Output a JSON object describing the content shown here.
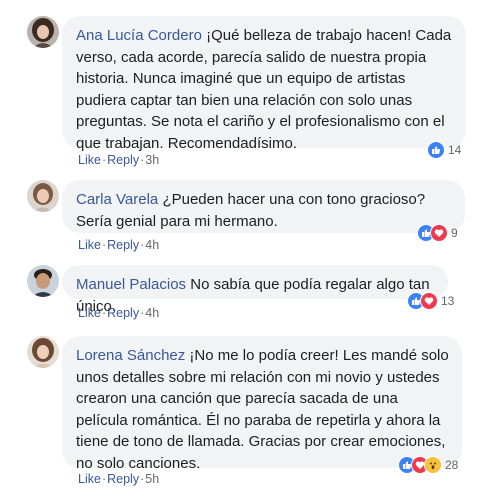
{
  "comments": [
    {
      "name": "Ana Lucía Cordero",
      "text": "¡Qué belleza de trabajo hacen! Cada verso, cada acorde, parecía salido de nuestra propia historia. Nunca imaginé que un equipo de artistas pudiera captar tan bien una relación con solo unas preguntas. Se nota el cariño y el profesionalismo con el que trabajan. Recomendadísimo.",
      "reactions": [
        "like-icon"
      ],
      "reaction_count": "14",
      "like_label": "Like",
      "reply_label": "Reply",
      "time": "3h"
    },
    {
      "name": "Carla Varela",
      "text": "¿Pueden hacer una con tono gracioso? Sería genial para mi hermano.",
      "reactions": [
        "like-icon",
        "love-icon"
      ],
      "reaction_count": "9",
      "like_label": "Like",
      "reply_label": "Reply",
      "time": "4h"
    },
    {
      "name": "Manuel Palacios",
      "text": "No sabía que podía regalar algo tan único.",
      "reactions": [
        "like-icon",
        "love-icon"
      ],
      "reaction_count": "13",
      "like_label": "Like",
      "reply_label": "Reply",
      "time": "4h"
    },
    {
      "name": "Lorena Sánchez",
      "text": "¡No me lo podía creer! Les mandé solo unos detalles sobre mi relación con mi novio y ustedes crearon una canción que parecía sacada de una película romántica. Él no paraba de repetirla y ahora la tiene de tono de llamada. Gracias por crear emociones, no solo canciones.",
      "reactions": [
        "like-icon",
        "love-icon",
        "wow-icon"
      ],
      "reaction_count": "28",
      "like_label": "Like",
      "reply_label": "Reply",
      "time": "5h"
    }
  ],
  "colors": {
    "name": "#385898",
    "bubble": "#f2f3f5",
    "like": "#3b82f6",
    "love": "#f0384f",
    "wow": "#f7c23a"
  }
}
